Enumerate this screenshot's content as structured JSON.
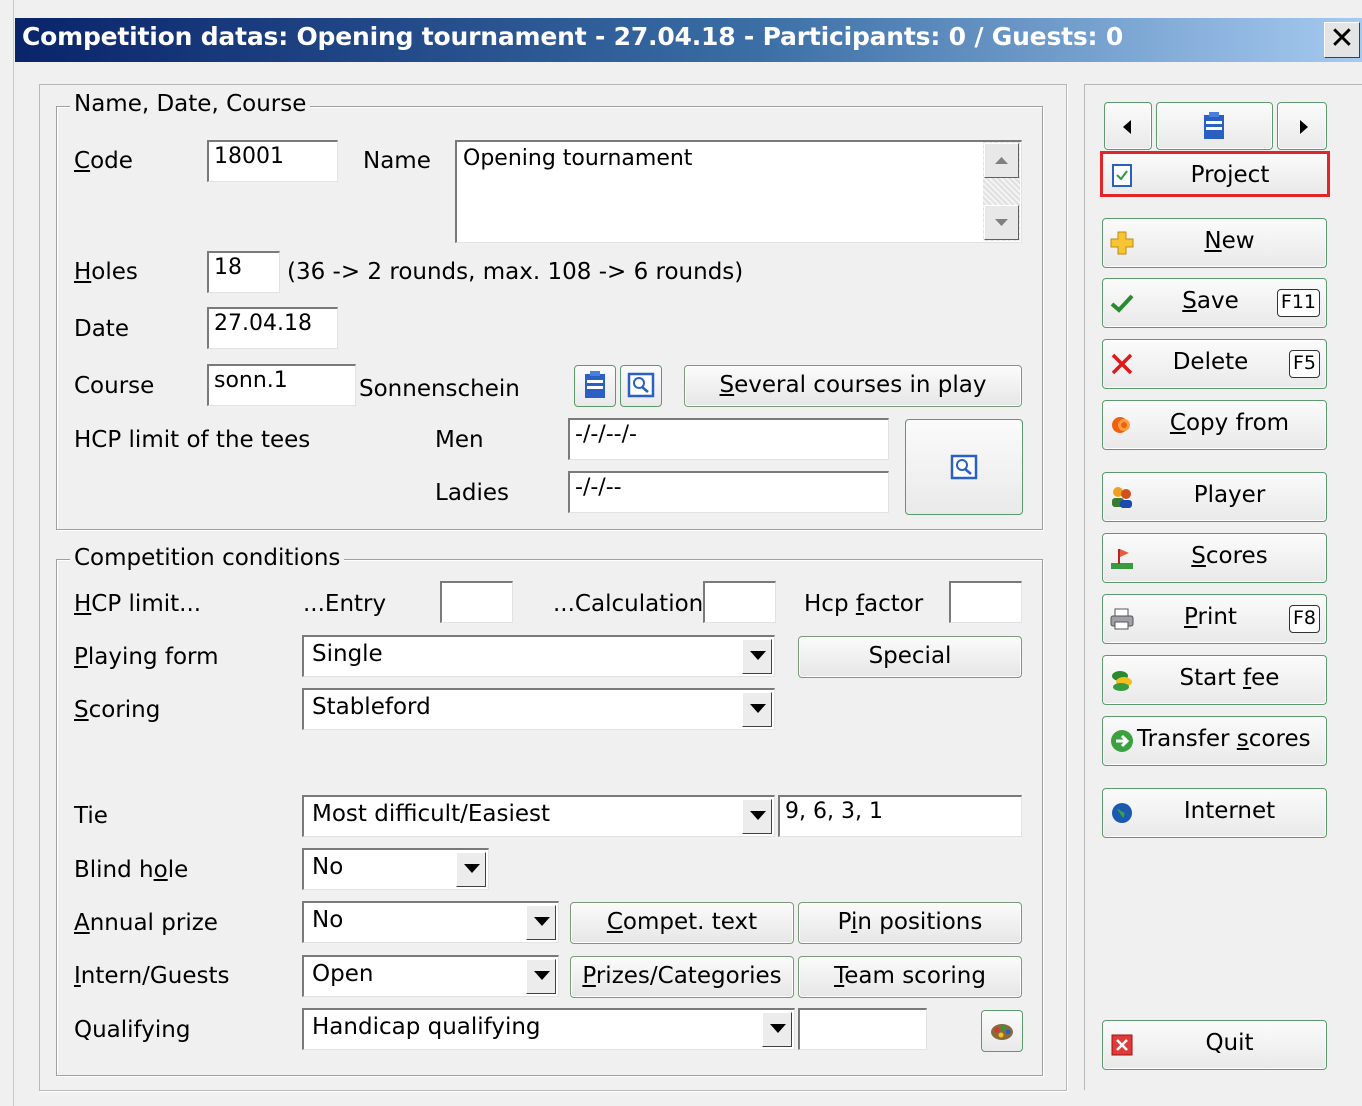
{
  "window": {
    "title": "Competition datas: Opening tournament - 27.04.18 - Participants: 0 / Guests: 0",
    "close_glyph": "✕"
  },
  "name_group": {
    "legend": "Name, Date, Course",
    "code_label": "Code",
    "code_value": "18001",
    "name_label": "Name",
    "name_value": "Opening tournament",
    "holes_label": "Holes",
    "holes_value": "18",
    "holes_hint": "(36 -> 2 rounds, max. 108 -> 6 rounds)",
    "date_label": "Date",
    "date_value": "27.04.18",
    "course_label": "Course",
    "course_value": "sonn.1",
    "course_name": "Sonnenschein",
    "several_courses_button": "Several courses in play",
    "hcp_limit_tees_label": "HCP limit of the tees",
    "men_label": "Men",
    "men_value": "-/-/--/-",
    "ladies_label": "Ladies",
    "ladies_value": "-/-/--"
  },
  "conditions_group": {
    "legend": "Competition conditions",
    "hcp_limit_label": "HCP limit...",
    "entry_label": "...Entry",
    "entry_value": "",
    "calculation_label": "...Calculation",
    "calculation_value": "",
    "hcp_factor_label": "Hcp factor",
    "hcp_factor_value": "",
    "playing_form_label": "Playing form",
    "playing_form_value": "Single",
    "special_button": "Special",
    "scoring_label": "Scoring",
    "scoring_value": "Stableford",
    "tie_label": "Tie",
    "tie_value": "Most difficult/Easiest",
    "tie_holes_value": "9, 6, 3, 1",
    "blind_hole_label": "Blind hole",
    "blind_hole_value": "No",
    "annual_prize_label": "Annual prize",
    "annual_prize_value": "No",
    "compet_text_button": "Compet. text",
    "pin_positions_button": "Pin positions",
    "intern_guests_label": "Intern/Guests",
    "intern_guests_value": "Open",
    "prizes_categories_button": "Prizes/Categories",
    "team_scoring_button": "Team scoring",
    "qualifying_label": "Qualifying",
    "qualifying_value": "Handicap qualifying",
    "qualifying_extra_value": ""
  },
  "sidebar": {
    "project": "Project",
    "new": "New",
    "save": "Save",
    "save_key": "F11",
    "delete": "Delete",
    "delete_key": "F5",
    "copy_from": "Copy from",
    "player": "Player",
    "scores": "Scores",
    "print": "Print",
    "print_key": "F8",
    "start_fee": "Start fee",
    "transfer_scores": "Transfer scores",
    "internet": "Internet",
    "quit": "Quit"
  },
  "colors": {
    "titlebar_start": "#0a246a",
    "titlebar_end": "#a6caf0",
    "highlight_outline": "#e0262b",
    "button_border": "#5c9a6e"
  }
}
